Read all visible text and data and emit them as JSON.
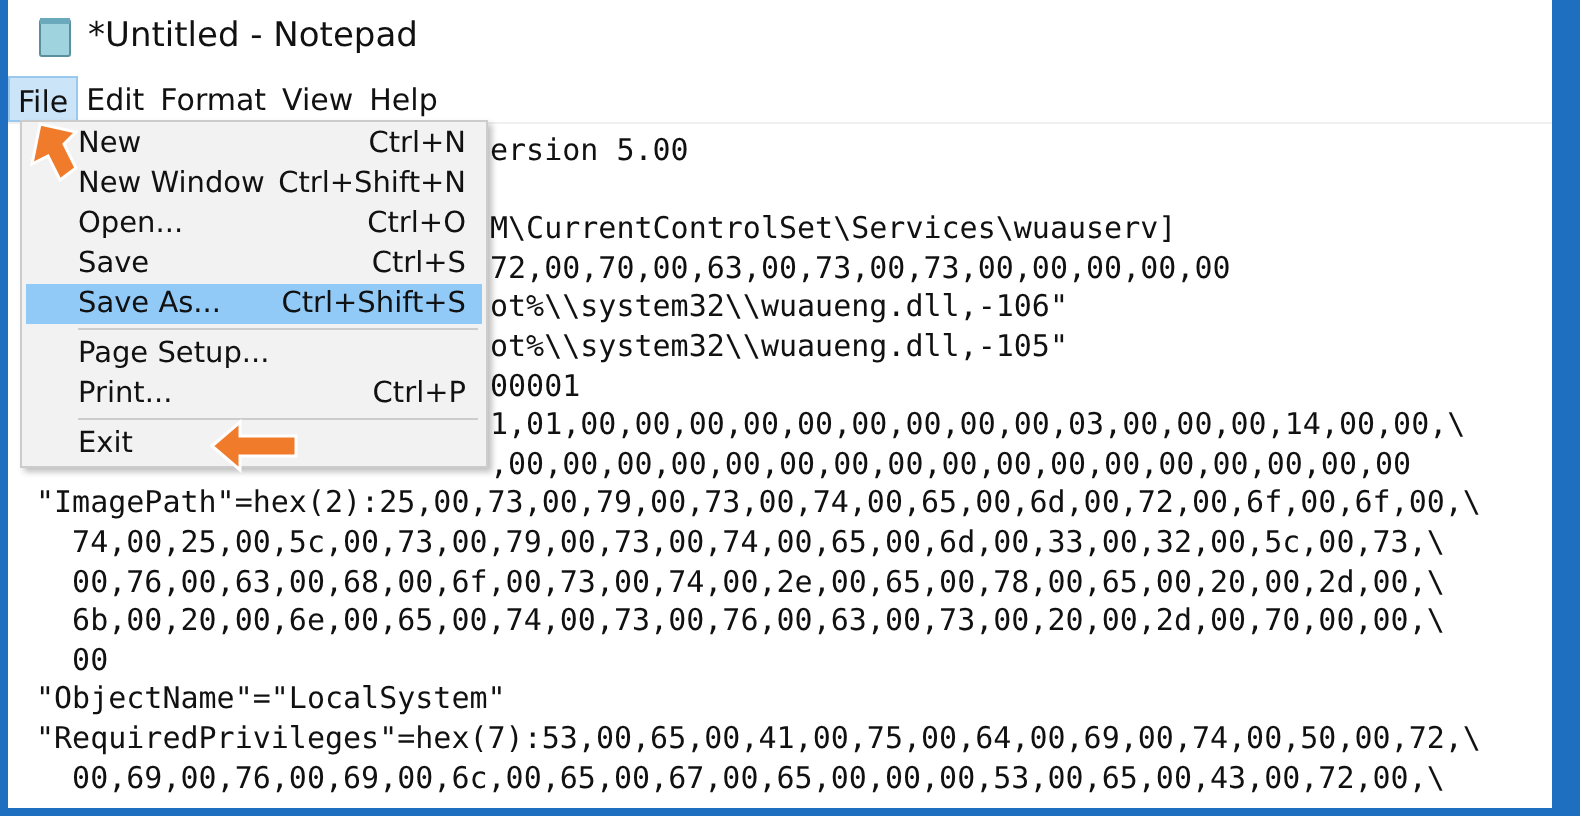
{
  "window": {
    "title": "*Untitled - Notepad"
  },
  "menubar": [
    {
      "label": "File",
      "selected": true
    },
    {
      "label": "Edit",
      "selected": false
    },
    {
      "label": "Format",
      "selected": false
    },
    {
      "label": "View",
      "selected": false
    },
    {
      "label": "Help",
      "selected": false
    }
  ],
  "file_menu": [
    {
      "kind": "item",
      "label": "New",
      "shortcut": "Ctrl+N",
      "selected": false
    },
    {
      "kind": "item",
      "label": "New Window",
      "shortcut": "Ctrl+Shift+N",
      "selected": false
    },
    {
      "kind": "item",
      "label": "Open...",
      "shortcut": "Ctrl+O",
      "selected": false
    },
    {
      "kind": "item",
      "label": "Save",
      "shortcut": "Ctrl+S",
      "selected": false
    },
    {
      "kind": "item",
      "label": "Save As...",
      "shortcut": "Ctrl+Shift+S",
      "selected": true
    },
    {
      "kind": "separator"
    },
    {
      "kind": "item",
      "label": "Page Setup...",
      "selected": false
    },
    {
      "kind": "item",
      "label": "Print...",
      "shortcut": "Ctrl+P",
      "selected": false
    },
    {
      "kind": "separator"
    },
    {
      "kind": "item",
      "label": "Exit",
      "selected": false
    }
  ],
  "editor_lines": [
    {
      "kind": "partial",
      "text": "ersion 5.00"
    },
    {
      "kind": "blank"
    },
    {
      "kind": "partial",
      "text": "M\\CurrentControlSet\\Services\\wuauserv]"
    },
    {
      "kind": "partial",
      "text": "72,00,70,00,63,00,73,00,73,00,00,00,00,00"
    },
    {
      "kind": "partial",
      "text": "ot%\\\\system32\\\\wuaueng.dll,-106\""
    },
    {
      "kind": "partial",
      "text": "ot%\\\\system32\\\\wuaueng.dll,-105\""
    },
    {
      "kind": "partial",
      "text": "00001"
    },
    {
      "kind": "partial",
      "text": "1,01,00,00,00,00,00,00,00,00,00,03,00,00,00,14,00,00,\\"
    },
    {
      "kind": "partial",
      "text": ",00,00,00,00,00,00,00,00,00,00,00,00,00,00,00,00,00"
    },
    {
      "kind": "full",
      "text": "\"ImagePath\"=hex(2):25,00,73,00,79,00,73,00,74,00,65,00,6d,00,72,00,6f,00,6f,00,\\"
    },
    {
      "kind": "full",
      "text": "  74,00,25,00,5c,00,73,00,79,00,73,00,74,00,65,00,6d,00,33,00,32,00,5c,00,73,\\"
    },
    {
      "kind": "full",
      "text": "  00,76,00,63,00,68,00,6f,00,73,00,74,00,2e,00,65,00,78,00,65,00,20,00,2d,00,\\"
    },
    {
      "kind": "full",
      "text": "  6b,00,20,00,6e,00,65,00,74,00,73,00,76,00,63,00,73,00,20,00,2d,00,70,00,00,\\"
    },
    {
      "kind": "full",
      "text": "  00"
    },
    {
      "kind": "full",
      "text": "\"ObjectName\"=\"LocalSystem\""
    },
    {
      "kind": "full",
      "text": "\"RequiredPrivileges\"=hex(7):53,00,65,00,41,00,75,00,64,00,69,00,74,00,50,00,72,\\"
    },
    {
      "kind": "full",
      "text": "  00,69,00,76,00,69,00,6c,00,65,00,67,00,65,00,00,00,53,00,65,00,43,00,72,00,\\"
    }
  ]
}
